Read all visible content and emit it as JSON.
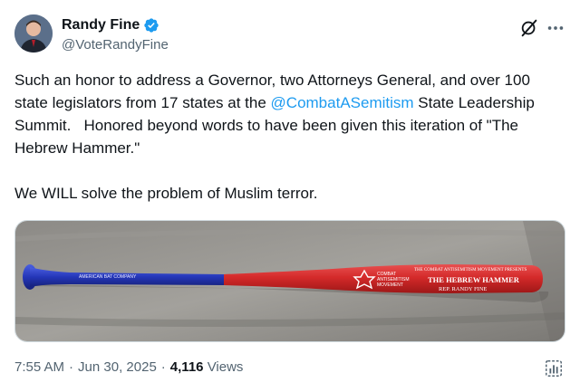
{
  "author": {
    "name": "Randy Fine",
    "handle": "@VoteRandyFine"
  },
  "tweet": {
    "text_part1": "Such an honor to address a Governor, two Attorneys General, and over 100 state legislators from 17 states at the ",
    "mention": "@CombatASemitism",
    "text_part2": " State Leadership Summit.   Honored beyond words to have been given this iteration of \"The Hebrew Hammer.\"\n\nWe WILL solve the problem of Muslim terror."
  },
  "media": {
    "bat_logo_line1": "COMBAT",
    "bat_logo_line2": "ANTISEMITISM",
    "bat_logo_line3": "MOVEMENT",
    "bat_top_text": "THE COMBAT ANTISEMITISM MOVEMENT PRESENTS",
    "bat_title": "THE HEBREW HAMMER",
    "bat_sub": "REP. RANDY FINE",
    "bat_barrel_text": "AMERICAN BAT COMPANY"
  },
  "meta": {
    "time": "7:55 AM",
    "date": "Jun 30, 2025",
    "views_count": "4,116",
    "views_label": "Views"
  },
  "colors": {
    "verified": "#1d9bf0",
    "bat_red": "#d42a2a",
    "bat_blue": "#2436b8"
  },
  "icons": [
    "verified-badge-icon",
    "grok-icon",
    "more-options-icon",
    "analytics-icon"
  ]
}
